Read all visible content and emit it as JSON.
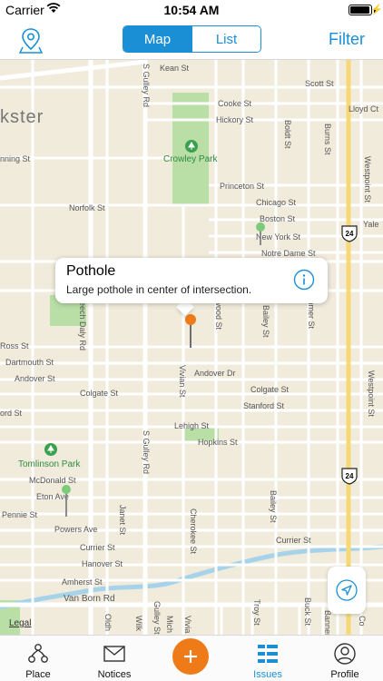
{
  "status_bar": {
    "carrier": "Carrier",
    "time": "10:54 AM"
  },
  "nav": {
    "segments": [
      {
        "label": "Map",
        "active": true
      },
      {
        "label": "List",
        "active": false
      }
    ],
    "filter_label": "Filter"
  },
  "map": {
    "city_label": "kster",
    "streets": {
      "s_gulley_rd_top": "S Gulley Rd",
      "s_gulley_rd_mid": "S Gulley Rd",
      "kean_st": "Kean St",
      "scott_st": "Scott St",
      "cooke_st": "Cooke St",
      "hickory_st": "Hickory St",
      "lloyd_ct": "Lloyd Ct",
      "boldt_st": "Boldt St",
      "burns_st_top": "Burns St",
      "westpoint_st_top": "Westpoint St",
      "nning_st": "nning St",
      "princeton_st": "Princeton St",
      "chicago_st": "Chicago St",
      "norfolk_st": "Norfolk St",
      "boston_st": "Boston St",
      "yale": "Yale",
      "new_york_st": "New York St",
      "notre_dame_st": "Notre Dame St",
      "each_daly_rd": "eech Daly Rd",
      "wood_st": "twood St",
      "bailey_st_top": "Bailey St",
      "mer_st": "mmer St",
      "ross_st": "Ross St",
      "dartmouth_st": "Dartmouth St",
      "andover_st": "Andover St",
      "andover_dr": "Andover Dr",
      "vivian_st": "Vivian St",
      "colgate_st_left": "Colgate St",
      "colgate_st_right": "Colgate St",
      "stanford_st": "Stanford St",
      "ord_st": "ord St",
      "westpoint_st_mid": "Westpoint St",
      "lehigh_st": "Lehigh St",
      "hopkins_st": "Hopkins St",
      "mcdonald_st": "McDonald St",
      "eton_ave": "Eton Ave",
      "pennie_st": "Pennie St",
      "powers_ave": "Powers Ave",
      "janet_st": "Janet St",
      "cherokee_st": "Cherokee St",
      "bailey_st_bottom": "Bailey St",
      "currier_st_left": "Currier St",
      "currier_st_right": "Currier St",
      "hanover_st": "Hanover St",
      "amherst_st": "Amherst St",
      "van_born_rd": "Van Born Rd",
      "oldh": "Oldh",
      "gulley_st_bottom": "Gulley St",
      "wilk": "Wilk",
      "mich": "Mich",
      "vivia": "Vivia",
      "troy_st": "Troy St",
      "buck_st": "Buck St",
      "banner_st": "Banner St",
      "co": "Co",
      "s_t": "S"
    },
    "highway_shields": [
      "24",
      "24"
    ],
    "parks": [
      "Crowley Park",
      "Tomlinson Park"
    ],
    "legal": "Legal"
  },
  "callout": {
    "title": "Pothole",
    "subtitle": "Large pothole in center of intersection."
  },
  "tabs": [
    {
      "label": "Place",
      "icon": "people-network-icon",
      "active": false
    },
    {
      "label": "Notices",
      "icon": "envelope-icon",
      "active": false
    },
    {
      "label": "",
      "icon": "plus-icon",
      "active": false
    },
    {
      "label": "Issues",
      "icon": "list-icon",
      "active": true
    },
    {
      "label": "Profile",
      "icon": "profile-icon",
      "active": false
    }
  ],
  "colors": {
    "accent": "#1a8fd6",
    "add_button": "#ef7a18",
    "map_background": "#f1ebdc",
    "park": "#b9dfa7",
    "water": "#a7d3ea"
  }
}
